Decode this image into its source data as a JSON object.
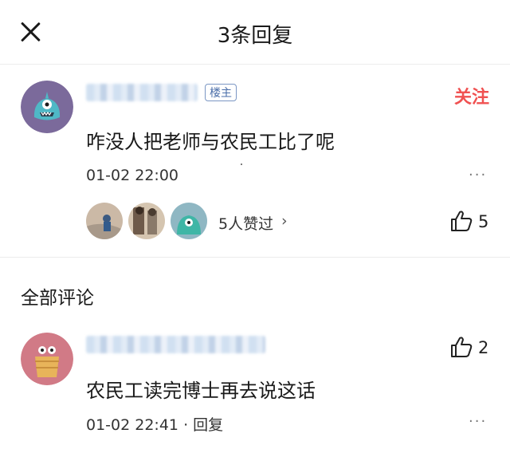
{
  "header": {
    "title": "3条回复",
    "close_icon": "close-icon"
  },
  "original_post": {
    "badge": "楼主",
    "follow_label": "关注",
    "text": "咋没人把老师与农民工比了呢",
    "time": "01-02 22:00",
    "more": "···",
    "likers_text": "5人赞过",
    "chevron": "›",
    "like_count": "5"
  },
  "section_title": "全部评论",
  "replies": [
    {
      "text": "农民工读完博士再去说这话",
      "time": "01-02 22:41",
      "separator": "·",
      "reply_label": "回复",
      "more": "···",
      "like_count": "2"
    }
  ],
  "colors": {
    "accent_red": "#f05151",
    "badge_blue": "#4a6ea9",
    "divider": "#ececec"
  }
}
